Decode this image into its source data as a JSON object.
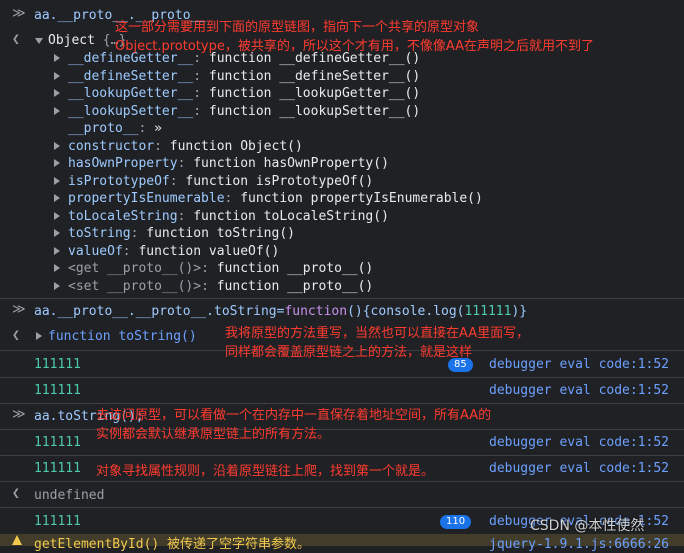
{
  "prompt_glyph": "≫",
  "result_glyph": "❮",
  "line1": {
    "text": "aa.__proto__.__proto__"
  },
  "object_line": {
    "label": "Object",
    "summary": "{…}"
  },
  "props": [
    {
      "key": "__defineGetter__",
      "val": "function __defineGetter__()"
    },
    {
      "key": "__defineSetter__",
      "val": "function __defineSetter__()"
    },
    {
      "key": "__lookupGetter__",
      "val": "function __lookupGetter__()"
    },
    {
      "key": "__lookupSetter__",
      "val": "function __lookupSetter__()"
    },
    {
      "key": "__proto__",
      "val": "»"
    },
    {
      "key": "constructor",
      "val": "function Object()"
    },
    {
      "key": "hasOwnProperty",
      "val": "function hasOwnProperty()"
    },
    {
      "key": "isPrototypeOf",
      "val": "function isPrototypeOf()"
    },
    {
      "key": "propertyIsEnumerable",
      "val": "function propertyIsEnumerable()"
    },
    {
      "key": "toLocaleString",
      "val": "function toLocaleString()"
    },
    {
      "key": "toString",
      "val": "function toString()"
    },
    {
      "key": "valueOf",
      "val": "function valueOf()"
    },
    {
      "key": "<get __proto__()>",
      "val": "function __proto__()"
    },
    {
      "key": "<set __proto__()>",
      "val": "function __proto__()"
    }
  ],
  "line2": {
    "prefix": "aa.__proto__.__proto__.toString=",
    "func_kw": "function",
    "body": "(){console.log(",
    "num": "111111",
    "suffix": ")}"
  },
  "result1": "function toString()",
  "outputs": [
    {
      "value": "111111",
      "source": "debugger eval code:1:52",
      "badge": "85"
    },
    {
      "value": "111111",
      "source": "debugger eval code:1:52",
      "badge": ""
    },
    {
      "value": "111111",
      "source": "debugger eval code:1:52",
      "badge": ""
    },
    {
      "value": "111111",
      "source": "debugger eval code:1:52",
      "badge": ""
    },
    {
      "value": "111111",
      "source": "debugger eval code:1:52",
      "badge": "110"
    }
  ],
  "line3": "aa.toString();",
  "undefined_text": "undefined",
  "warn_text": "getElementById() 被传递了空字符串参数。",
  "warn_source": "jquery-1.9.1.js:6666:26",
  "annotations": {
    "a1": "这一部分需要用到下面的原型链图，指向下一个共享的原型对象\nObject.prototype，被共享的，所以这个才有用，不像像AA在声明之后就用不到了",
    "a2": "我将原型的方法重写，当然也可以直接在AA里面写，\n同样都会覆盖原型链之上的方法，就是这样",
    "a3": "去访问原型，可以看做一个在内存中一直保存着地址空间，所有AA的\n实例都会默认继承原型链上的所有方法。",
    "a4": "对象寻找属性规则，沿着原型链往上爬，找到第一个就是。"
  },
  "watermark": "CSDN @本性使然"
}
